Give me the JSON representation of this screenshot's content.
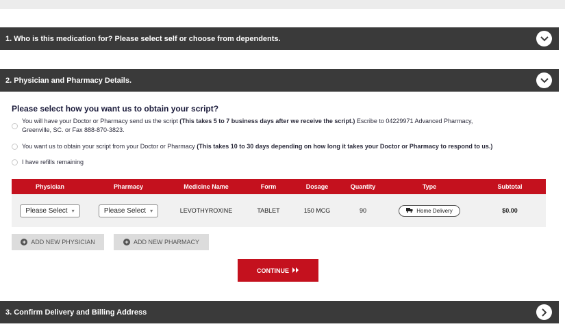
{
  "sections": [
    {
      "title": "1. Who is this medication for? Please select self or choose from dependents."
    },
    {
      "title": "2. Physician and Pharmacy Details."
    },
    {
      "title": "3. Confirm Delivery and Billing Address"
    }
  ],
  "script": {
    "question": "Please select how you want us to obtain your script?",
    "options": [
      {
        "line1_plain": "You will have your Doctor or Pharmacy send us the script ",
        "line1_bold": "(This takes 5 to 7 business days after we receive the script.)",
        "line1_tail": " Escribe to 04229971 Advanced Pharmacy,",
        "line2": "Greenville, SC. or Fax 888-870-3823."
      },
      {
        "plain": "You want us to obtain your script from your Doctor or Pharmacy ",
        "bold": "(This takes 10 to 30 days depending on how long it takes your Doctor or Pharmacy to respond to us.)"
      },
      {
        "plain": "I have refills remaining"
      }
    ]
  },
  "table": {
    "headers": [
      "Physician",
      "Pharmacy",
      "Medicine Name",
      "Form",
      "Dosage",
      "Quantity",
      "Type",
      "Subtotal"
    ],
    "row": {
      "physician": "Please Select",
      "pharmacy": "Please Select",
      "medicine": "LEVOTHYROXINE",
      "form": "TABLET",
      "dosage": "150 MCG",
      "quantity": "90",
      "type": "Home Delivery",
      "subtotal": "$0.00"
    }
  },
  "buttons": {
    "add_physician": "ADD NEW PHYSICIAN",
    "add_pharmacy": "ADD NEW PHARMACY",
    "continue": "CONTINUE"
  },
  "colors": {
    "accent": "#c4111e",
    "header": "#3a3a3a"
  },
  "icons": [
    "chevron-down-icon",
    "chevron-right-icon",
    "plus-circle-icon",
    "truck-icon",
    "double-chevron-right-icon"
  ]
}
